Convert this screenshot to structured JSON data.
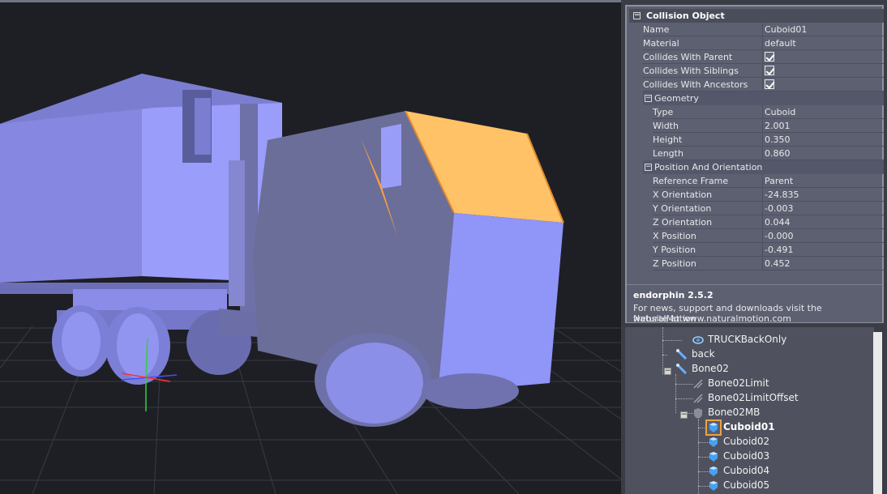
{
  "properties": {
    "section_title": "Collision Object",
    "rows": [
      {
        "key": "Name",
        "value": "Cuboid01"
      },
      {
        "key": "Material",
        "value": "default"
      }
    ],
    "checks": [
      {
        "key": "Collides With Parent",
        "checked": true
      },
      {
        "key": "Collides With Siblings",
        "checked": true
      },
      {
        "key": "Collides With Ancestors",
        "checked": true
      }
    ],
    "geometry": {
      "title": "Geometry",
      "rows": [
        {
          "key": "Type",
          "value": "Cuboid"
        },
        {
          "key": "Width",
          "value": "2.001"
        },
        {
          "key": "Height",
          "value": "0.350"
        },
        {
          "key": "Length",
          "value": "0.860"
        }
      ]
    },
    "position": {
      "title": "Position And Orientation",
      "rows": [
        {
          "key": "Reference Frame",
          "value": "Parent"
        },
        {
          "key": "X Orientation",
          "value": "-24.835"
        },
        {
          "key": "Y Orientation",
          "value": "-0.003"
        },
        {
          "key": "Z Orientation",
          "value": "0.044"
        },
        {
          "key": "X Position",
          "value": "-0.000"
        },
        {
          "key": "Y Position",
          "value": "-0.491"
        },
        {
          "key": "Z Position",
          "value": "0.452"
        }
      ]
    }
  },
  "about": {
    "title": "endorphin 2.5.2",
    "line1": "For news, support and downloads visit the NaturalMotion",
    "line2": "website at www.naturalmotion.com"
  },
  "tree": {
    "items": [
      {
        "label": "TRUCKBackOnly",
        "icon": "mesh-icon"
      },
      {
        "label": "back",
        "icon": "bone-icon"
      },
      {
        "label": "Bone02",
        "icon": "bone-icon"
      },
      {
        "label": "Bone02Limit",
        "icon": "limit-icon"
      },
      {
        "label": "Bone02LimitOffset",
        "icon": "limit-icon"
      },
      {
        "label": "Bone02MB",
        "icon": "shield-icon"
      },
      {
        "label": "Cuboid01",
        "icon": "cuboid-icon",
        "selected": true
      },
      {
        "label": "Cuboid02",
        "icon": "cuboid-icon"
      },
      {
        "label": "Cuboid03",
        "icon": "cuboid-icon"
      },
      {
        "label": "Cuboid04",
        "icon": "cuboid-icon"
      },
      {
        "label": "Cuboid05",
        "icon": "cuboid-icon"
      }
    ]
  },
  "colors": {
    "viewport_bg": "#1e1f25",
    "truck_body": "#9094f8",
    "selection": "#ffc266"
  }
}
